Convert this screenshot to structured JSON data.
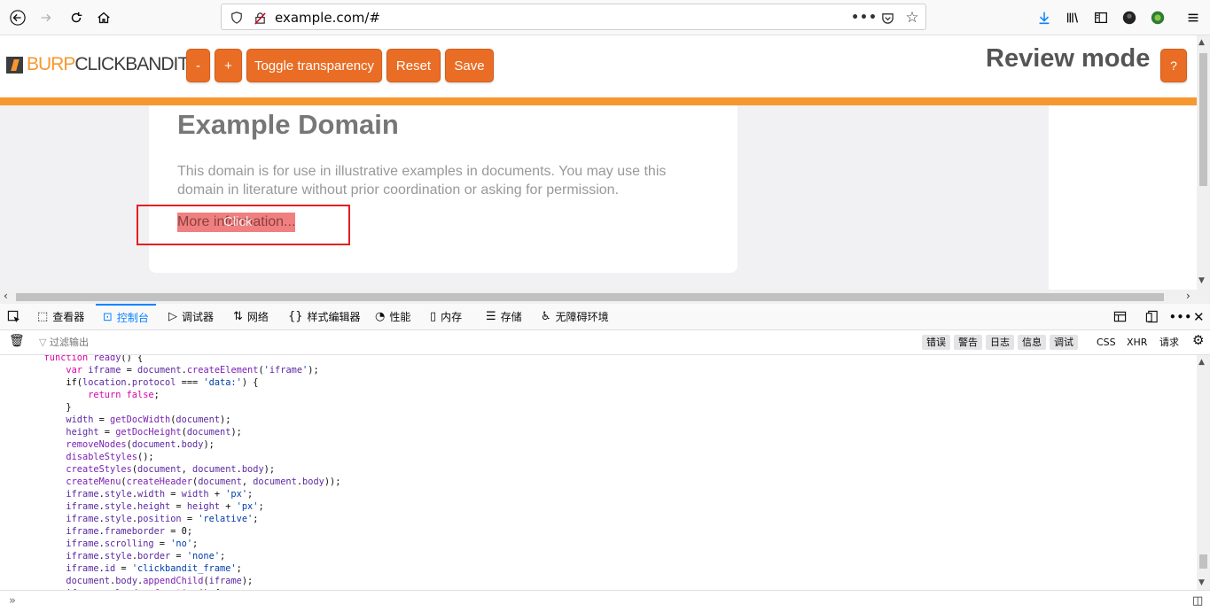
{
  "browser": {
    "url": "example.com/#",
    "icons": [
      "back-icon",
      "forward-icon",
      "reload-icon",
      "home-icon",
      "shield-icon",
      "insecure-icon",
      "page-actions-icon",
      "pocket-icon",
      "bookmark-star-icon",
      "download-icon",
      "library-icon",
      "sidebar-icon",
      "account-icon",
      "extension-icon",
      "menu-icon"
    ]
  },
  "burp": {
    "logo_burp": "BURP",
    "logo_clickbandit": "CLICKBANDIT",
    "buttons": {
      "minus": "-",
      "plus": "+",
      "toggle": "Toggle transparency",
      "reset": "Reset",
      "save": "Save",
      "help": "?"
    },
    "review_mode": "Review mode",
    "accent": "#f7972f",
    "button_color": "#e96d24"
  },
  "example": {
    "title": "Example Domain",
    "text": "This domain is for use in illustrative examples in documents. You may use this domain in literature without prior coordination or asking for permission.",
    "link": "More information...",
    "click_label": "Click"
  },
  "devtools": {
    "tabs": [
      "查看器",
      "控制台",
      "调试器",
      "网络",
      "样式编辑器",
      "性能",
      "内存",
      "存储",
      "无障碍环境"
    ],
    "active_tab": "控制台",
    "filter_placeholder": "过滤输出",
    "filters": [
      "错误",
      "警告",
      "日志",
      "信息",
      "调试"
    ],
    "extra_filters": [
      "CSS",
      "XHR",
      "请求"
    ]
  },
  "console_code": [
    "        function ready() {",
    "            var iframe = document.createElement('iframe');",
    "            if(location.protocol === 'data:') {",
    "                return false;",
    "            }",
    "            width = getDocWidth(document);",
    "            height = getDocHeight(document);",
    "            removeNodes(document.body);",
    "            disableStyles();",
    "            createStyles(document, document.body);",
    "            createMenu(createHeader(document, document.body));",
    "            iframe.style.width = width + 'px';",
    "            iframe.style.height = height + 'px';",
    "            iframe.style.position = 'relative';",
    "            iframe.frameborder = 0;",
    "            iframe.scrolling = 'no';",
    "            iframe.style.border = 'none';",
    "            iframe.id = 'clickbandit_frame';",
    "            document.body.appendChild(iframe);",
    "            iframe.onload = function() {"
  ]
}
